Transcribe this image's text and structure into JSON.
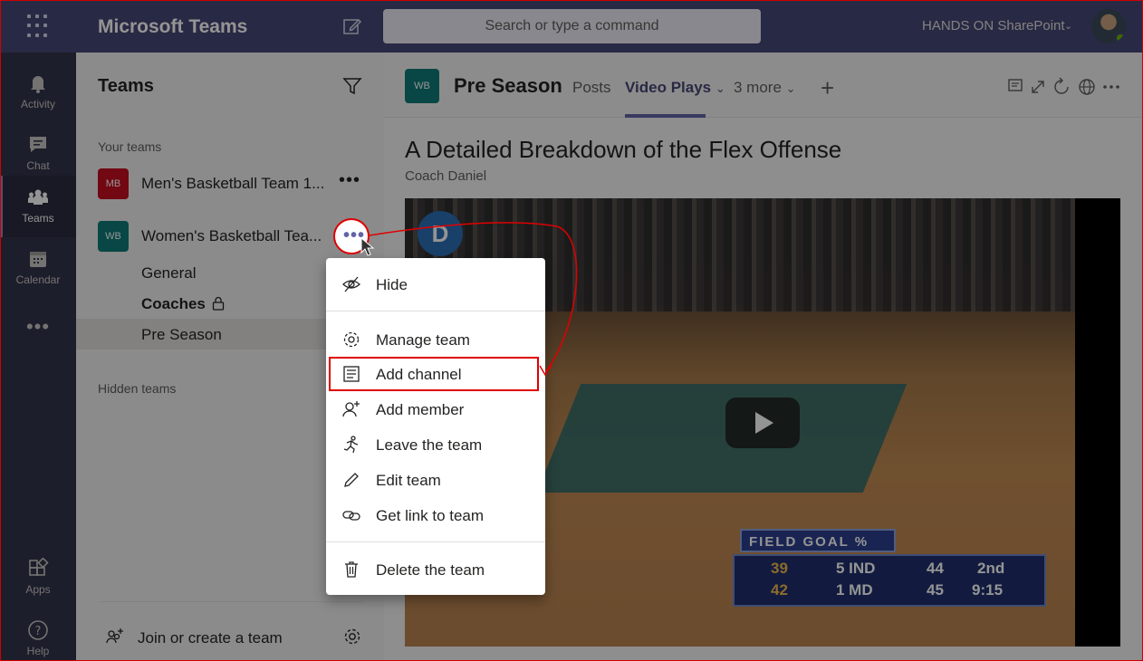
{
  "topbar": {
    "app_title": "Microsoft Teams",
    "search_placeholder": "Search or type a command",
    "tenant": "HANDS ON SharePoint"
  },
  "rail": {
    "items": [
      {
        "label": "Activity",
        "icon": "bell-icon"
      },
      {
        "label": "Chat",
        "icon": "chat-icon"
      },
      {
        "label": "Teams",
        "icon": "teams-icon"
      },
      {
        "label": "Calendar",
        "icon": "calendar-icon"
      },
      {
        "label": "Apps",
        "icon": "apps-icon"
      },
      {
        "label": "Help",
        "icon": "help-icon"
      }
    ],
    "more": "•••"
  },
  "teams_panel": {
    "title": "Teams",
    "your_teams_label": "Your teams",
    "teams": [
      {
        "initials": "MB",
        "name": "Men's Basketball Team 1...",
        "color": "#c50f1f"
      },
      {
        "initials": "WB",
        "name": "Women's Basketball Tea...",
        "color": "#0e7a77"
      }
    ],
    "channels": [
      "General",
      "Coaches",
      "Pre Season"
    ],
    "hidden_teams_label": "Hidden teams",
    "join_label": "Join or create a team",
    "more_dots": "•••"
  },
  "channel_header": {
    "initials": "WB",
    "title": "Pre Season",
    "tabs": [
      "Posts",
      "Video Plays",
      "3 more"
    ],
    "add_tab": "+"
  },
  "article": {
    "title": "A Detailed Breakdown of the Flex Offense",
    "author": "Coach Daniel"
  },
  "video": {
    "logo": "D",
    "scoreboard_title": "FIELD GOAL %",
    "home_pct": "39",
    "away_pct": "42",
    "home_team": "5 IND",
    "away_team": "1 MD",
    "home_score": "44",
    "away_score": "45",
    "period": "2nd",
    "clock": "9:15"
  },
  "context_menu": {
    "items": [
      {
        "label": "Hide",
        "icon": "hide-icon"
      },
      {
        "label": "Manage team",
        "icon": "gear-icon"
      },
      {
        "label": "Add channel",
        "icon": "add-channel-icon"
      },
      {
        "label": "Add member",
        "icon": "add-member-icon"
      },
      {
        "label": "Leave the team",
        "icon": "leave-icon"
      },
      {
        "label": "Edit team",
        "icon": "pencil-icon"
      },
      {
        "label": "Get link to team",
        "icon": "link-icon"
      },
      {
        "label": "Delete the team",
        "icon": "trash-icon"
      }
    ]
  },
  "colors": {
    "topbar": "#464775",
    "rail": "#33344a",
    "accent": "#6264a7",
    "annotation": "#e00000"
  }
}
